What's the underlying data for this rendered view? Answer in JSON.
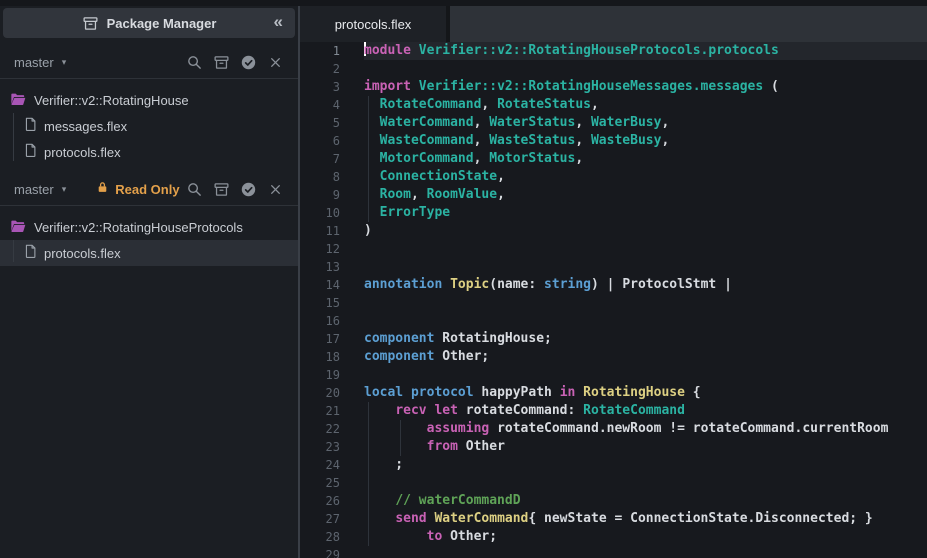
{
  "sidebar": {
    "header": {
      "title": "Package Manager",
      "icon": "package",
      "collapse_icon": "«"
    },
    "toolbar_icons": [
      "search",
      "package",
      "check-circle",
      "close"
    ],
    "sections": [
      {
        "branch": "master",
        "read_only": null,
        "tree": {
          "folder": "Verifier::v2::RotatingHouse",
          "files": [
            {
              "name": "messages.flex",
              "selected": false
            },
            {
              "name": "protocols.flex",
              "selected": false
            }
          ]
        }
      },
      {
        "branch": "master",
        "read_only": "Read Only",
        "tree": {
          "folder": "Verifier::v2::RotatingHouseProtocols",
          "files": [
            {
              "name": "protocols.flex",
              "selected": true
            }
          ]
        }
      }
    ]
  },
  "editor": {
    "tab": "protocols.flex",
    "active_line": 1,
    "lines": [
      {
        "n": 1,
        "cur": true,
        "cursor": true,
        "spans": [
          [
            "kw",
            "module"
          ],
          [
            "fg",
            " "
          ],
          [
            "ty",
            "Verifier::v2::RotatingHouseProtocols.protocols"
          ]
        ]
      },
      {
        "n": 2,
        "spans": []
      },
      {
        "n": 3,
        "spans": [
          [
            "kw",
            "import"
          ],
          [
            "fg",
            " "
          ],
          [
            "ty",
            "Verifier::v2::RotatingHouseMessages.messages"
          ],
          [
            "fg",
            " ("
          ]
        ]
      },
      {
        "n": 4,
        "spans": [
          [
            "fg",
            "  "
          ],
          [
            "ty",
            "RotateCommand"
          ],
          [
            "fg",
            ", "
          ],
          [
            "ty",
            "RotateStatus"
          ],
          [
            "fg",
            ","
          ]
        ]
      },
      {
        "n": 5,
        "spans": [
          [
            "fg",
            "  "
          ],
          [
            "ty",
            "WaterCommand"
          ],
          [
            "fg",
            ", "
          ],
          [
            "ty",
            "WaterStatus"
          ],
          [
            "fg",
            ", "
          ],
          [
            "ty",
            "WaterBusy"
          ],
          [
            "fg",
            ","
          ]
        ]
      },
      {
        "n": 6,
        "spans": [
          [
            "fg",
            "  "
          ],
          [
            "ty",
            "WasteCommand"
          ],
          [
            "fg",
            ", "
          ],
          [
            "ty",
            "WasteStatus"
          ],
          [
            "fg",
            ", "
          ],
          [
            "ty",
            "WasteBusy"
          ],
          [
            "fg",
            ","
          ]
        ]
      },
      {
        "n": 7,
        "spans": [
          [
            "fg",
            "  "
          ],
          [
            "ty",
            "MotorCommand"
          ],
          [
            "fg",
            ", "
          ],
          [
            "ty",
            "MotorStatus"
          ],
          [
            "fg",
            ","
          ]
        ]
      },
      {
        "n": 8,
        "spans": [
          [
            "fg",
            "  "
          ],
          [
            "ty",
            "ConnectionState"
          ],
          [
            "fg",
            ","
          ]
        ]
      },
      {
        "n": 9,
        "spans": [
          [
            "fg",
            "  "
          ],
          [
            "ty",
            "Room"
          ],
          [
            "fg",
            ", "
          ],
          [
            "ty",
            "RoomValue"
          ],
          [
            "fg",
            ","
          ]
        ]
      },
      {
        "n": 10,
        "spans": [
          [
            "fg",
            "  "
          ],
          [
            "ty",
            "ErrorType"
          ]
        ]
      },
      {
        "n": 11,
        "spans": [
          [
            "fg",
            ")"
          ]
        ]
      },
      {
        "n": 12,
        "spans": []
      },
      {
        "n": 13,
        "spans": []
      },
      {
        "n": 14,
        "spans": [
          [
            "bl",
            "annotation"
          ],
          [
            "fg",
            " "
          ],
          [
            "yl",
            "Topic"
          ],
          [
            "fg",
            "(name: "
          ],
          [
            "bl",
            "string"
          ],
          [
            "fg",
            ") | ProtocolStmt |"
          ]
        ]
      },
      {
        "n": 15,
        "spans": []
      },
      {
        "n": 16,
        "spans": []
      },
      {
        "n": 17,
        "spans": [
          [
            "bl",
            "component"
          ],
          [
            "fg",
            " RotatingHouse;"
          ]
        ]
      },
      {
        "n": 18,
        "spans": [
          [
            "bl",
            "component"
          ],
          [
            "fg",
            " Other;"
          ]
        ]
      },
      {
        "n": 19,
        "spans": []
      },
      {
        "n": 20,
        "spans": [
          [
            "bl",
            "local"
          ],
          [
            "fg",
            " "
          ],
          [
            "bl",
            "protocol"
          ],
          [
            "fg",
            " happyPath "
          ],
          [
            "kw",
            "in"
          ],
          [
            "fg",
            " "
          ],
          [
            "yl",
            "RotatingHouse"
          ],
          [
            "fg",
            " {"
          ]
        ]
      },
      {
        "n": 21,
        "spans": [
          [
            "fg",
            "    "
          ],
          [
            "kw",
            "recv"
          ],
          [
            "fg",
            " "
          ],
          [
            "kw",
            "let"
          ],
          [
            "fg",
            " rotateCommand: "
          ],
          [
            "ty",
            "RotateCommand"
          ]
        ]
      },
      {
        "n": 22,
        "spans": [
          [
            "fg",
            "        "
          ],
          [
            "kw",
            "assuming"
          ],
          [
            "fg",
            " rotateCommand.newRoom != rotateCommand.currentRoom"
          ]
        ]
      },
      {
        "n": 23,
        "spans": [
          [
            "fg",
            "        "
          ],
          [
            "kw",
            "from"
          ],
          [
            "fg",
            " Other"
          ]
        ]
      },
      {
        "n": 24,
        "spans": [
          [
            "fg",
            "    ;"
          ]
        ]
      },
      {
        "n": 25,
        "spans": []
      },
      {
        "n": 26,
        "spans": [
          [
            "fg",
            "    "
          ],
          [
            "cm",
            "// waterCommandD"
          ]
        ]
      },
      {
        "n": 27,
        "spans": [
          [
            "fg",
            "    "
          ],
          [
            "kw",
            "send"
          ],
          [
            "fg",
            " "
          ],
          [
            "yl",
            "WaterCommand"
          ],
          [
            "fg",
            "{ newState = ConnectionState.Disconnected; }"
          ]
        ]
      },
      {
        "n": 28,
        "spans": [
          [
            "fg",
            "        "
          ],
          [
            "kw",
            "to"
          ],
          [
            "fg",
            " Other;"
          ]
        ]
      },
      {
        "n": 29,
        "spans": []
      }
    ]
  },
  "colors": {
    "editor_bg": "#17191e",
    "sidebar_bg": "#1b1e23",
    "folder_purple": "#a855b5",
    "readonly_orange": "#e3a04a",
    "syntax": {
      "keyword_pink": "#c962b5",
      "type_teal": "#2bb3a3",
      "decl_blue": "#5c9fd3",
      "class_yellow": "#ddd083",
      "text": "#d8dbe0",
      "comment_green": "#5fa357"
    }
  }
}
